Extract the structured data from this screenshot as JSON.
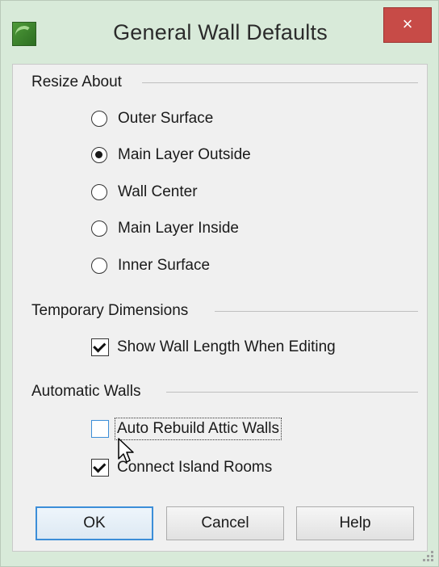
{
  "window": {
    "title": "General Wall Defaults",
    "close_label": "×"
  },
  "groups": {
    "resize_about": {
      "label": "Resize About",
      "options": [
        {
          "label": "Outer Surface",
          "selected": false
        },
        {
          "label": "Main Layer Outside",
          "selected": true
        },
        {
          "label": "Wall Center",
          "selected": false
        },
        {
          "label": "Main Layer Inside",
          "selected": false
        },
        {
          "label": "Inner Surface",
          "selected": false
        }
      ]
    },
    "temporary_dimensions": {
      "label": "Temporary Dimensions",
      "show_wall_length": {
        "label": "Show Wall Length When Editing",
        "checked": true
      }
    },
    "automatic_walls": {
      "label": "Automatic Walls",
      "auto_rebuild": {
        "label": "Auto Rebuild Attic Walls",
        "checked": false
      },
      "connect_island": {
        "label": "Connect Island Rooms",
        "checked": true
      }
    }
  },
  "buttons": {
    "ok": "OK",
    "cancel": "Cancel",
    "help": "Help"
  },
  "colors": {
    "frame": "#d8ead9",
    "close": "#c74b47",
    "focus_blue": "#3c8ed8"
  }
}
